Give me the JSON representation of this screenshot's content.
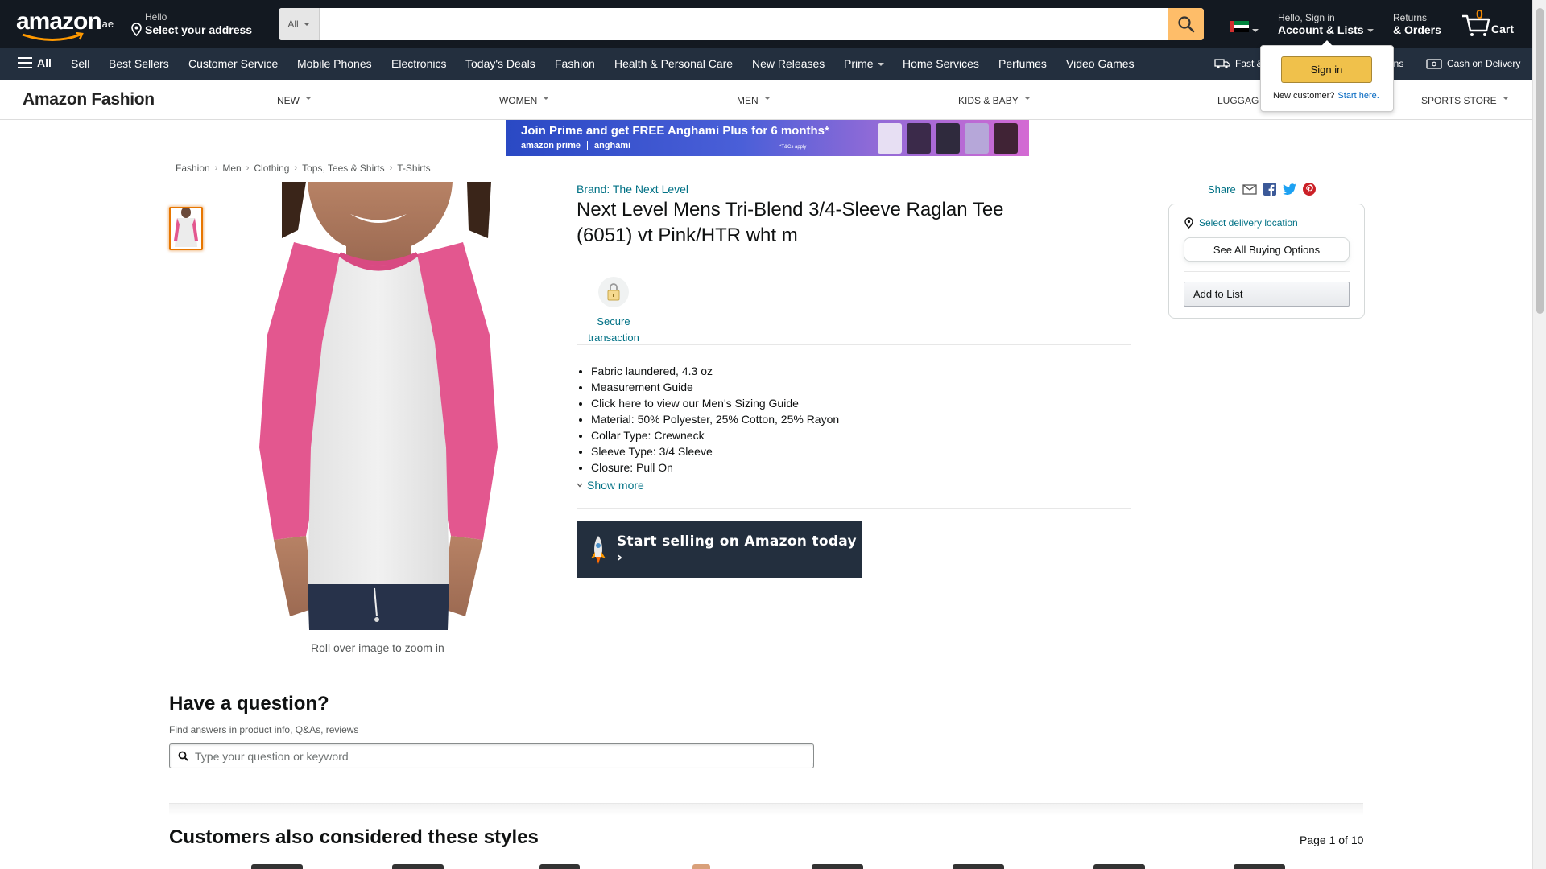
{
  "header": {
    "logo_text": "amazon",
    "logo_tld": ".ae",
    "address_line1": "Hello",
    "address_line2": "Select your address",
    "search_dept": "All",
    "search_placeholder": "",
    "account_line1": "Hello, Sign in",
    "account_line2": "Account & Lists",
    "returns_line1": "Returns",
    "returns_line2": "& Orders",
    "cart_count": "0",
    "cart_label": "Cart"
  },
  "nav": {
    "all_label": "All",
    "items": [
      "Sell",
      "Best Sellers",
      "Customer Service",
      "Mobile Phones",
      "Electronics",
      "Today's Deals",
      "Fashion",
      "Health & Personal Care",
      "New Releases",
      "Prime",
      "Home Services",
      "Perfumes",
      "Video Games"
    ],
    "right_items": [
      "Fast &",
      "urns",
      "Cash on Delivery"
    ]
  },
  "flyout": {
    "signin_label": "Sign in",
    "new_customer": "New customer?",
    "start_here": "Start here."
  },
  "subnav": {
    "brand": "Amazon Fashion",
    "categories": [
      "NEW",
      "WOMEN",
      "MEN",
      "KIDS & BABY",
      "LUGGAG",
      "SPORTS STORE"
    ]
  },
  "banner": {
    "headline": "Join Prime and get FREE Anghami Plus for 6 months*",
    "brand1": "amazon prime",
    "brand2": "anghami",
    "tc": "*T&Cs apply"
  },
  "breadcrumb": [
    "Fashion",
    "Men",
    "Clothing",
    "Tops, Tees & Shirts",
    "T-Shirts"
  ],
  "product": {
    "brand_link": "Brand: The Next Level",
    "title": "Next Level Mens Tri-Blend 3/4-Sleeve Raglan Tee (6051) vt Pink/HTR wht m",
    "zoom_hint": "Roll over image to zoom in",
    "secure_label": "Secure transaction",
    "bullets": [
      "Fabric laundered, 4.3 oz",
      "Measurement Guide",
      "Click here to view our Men's Sizing Guide",
      "Material: 50% Polyester, 25% Cotton, 25% Rayon",
      "Collar Type: Crewneck",
      "Sleeve Type: 3/4 Sleeve",
      "Closure: Pull On"
    ],
    "show_more": "Show more",
    "sell_banner": "Start selling on Amazon today ›"
  },
  "share": {
    "label": "Share"
  },
  "buybox": {
    "delivery": "Select delivery location",
    "see_all": "See All Buying Options",
    "add_to_list": "Add to List"
  },
  "qa": {
    "title": "Have a question?",
    "subtitle": "Find answers in product info, Q&As, reviews",
    "placeholder": "Type your question or keyword"
  },
  "also": {
    "title": "Customers also considered these styles",
    "page": "Page 1 of 10"
  },
  "colors": {
    "nav_dark": "#131921",
    "nav_main": "#232f3e",
    "search_button": "#febd69",
    "link": "#007185",
    "shirt_pink": "#e3578f"
  }
}
